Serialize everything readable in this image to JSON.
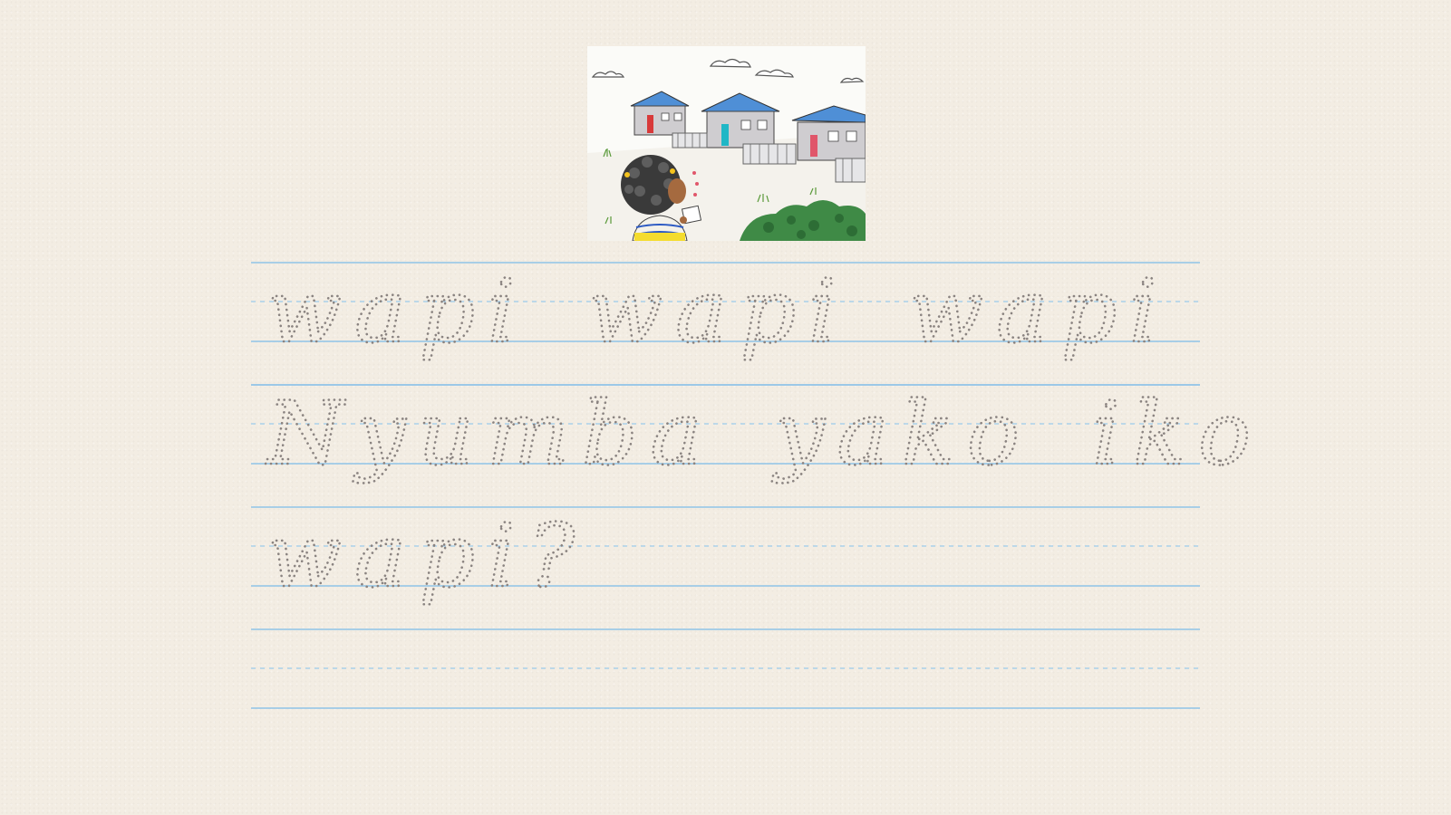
{
  "illustration": {
    "icon": "houses-and-girl-illustration"
  },
  "worksheet": {
    "lines": [
      {
        "text": "wapi wapi wapi"
      },
      {
        "text": "Nyumba yako iko"
      },
      {
        "text": "wapi?"
      },
      {
        "text": ""
      }
    ],
    "colors": {
      "ruling": "#8fc3e8",
      "trace": "#8a8380",
      "paper": "#f3ede3"
    }
  }
}
